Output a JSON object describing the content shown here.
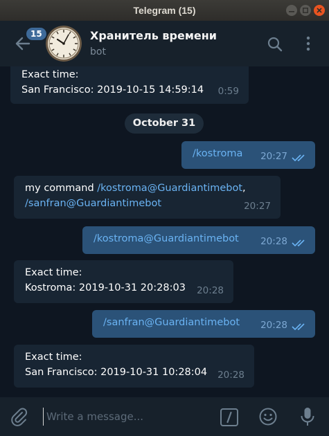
{
  "window": {
    "title": "Telegram (15)"
  },
  "header": {
    "unread_badge": "15",
    "chat_title": "Хранитель времени",
    "chat_subtitle": "bot"
  },
  "messages": [
    {
      "dir": "in",
      "lines": [
        "Exact time:",
        "San Francisco: 2019-10-15 14:59:14"
      ],
      "time": "0:59"
    },
    {
      "dir": "out",
      "text": "/kostroma",
      "time": "20:27"
    },
    {
      "dir": "in",
      "prefix": "my command ",
      "link1": "/kostroma@Guardiantimebot",
      "sep": ",",
      "link2": "/sanfran@Guardiantimebot",
      "time": "20:27"
    },
    {
      "dir": "out",
      "text": "/kostroma@Guardiantimebot",
      "time": "20:28"
    },
    {
      "dir": "in",
      "lines": [
        "Exact time:",
        "Kostroma: 2019-10-31 20:28:03"
      ],
      "time": "20:28"
    },
    {
      "dir": "out",
      "text": "/sanfran@Guardiantimebot",
      "time": "20:28"
    },
    {
      "dir": "in",
      "lines": [
        "Exact time:",
        "San Francisco: 2019-10-31 10:28:04"
      ],
      "time": "20:28"
    }
  ],
  "date_separator": "October 31",
  "composer": {
    "placeholder": "Write a message..."
  },
  "colors": {
    "background": "#0e1621",
    "header": "#17212b",
    "incoming_bubble": "#182533",
    "outgoing_bubble": "#2b5278",
    "link": "#6ab3f3",
    "accent": "#3e6a99"
  }
}
